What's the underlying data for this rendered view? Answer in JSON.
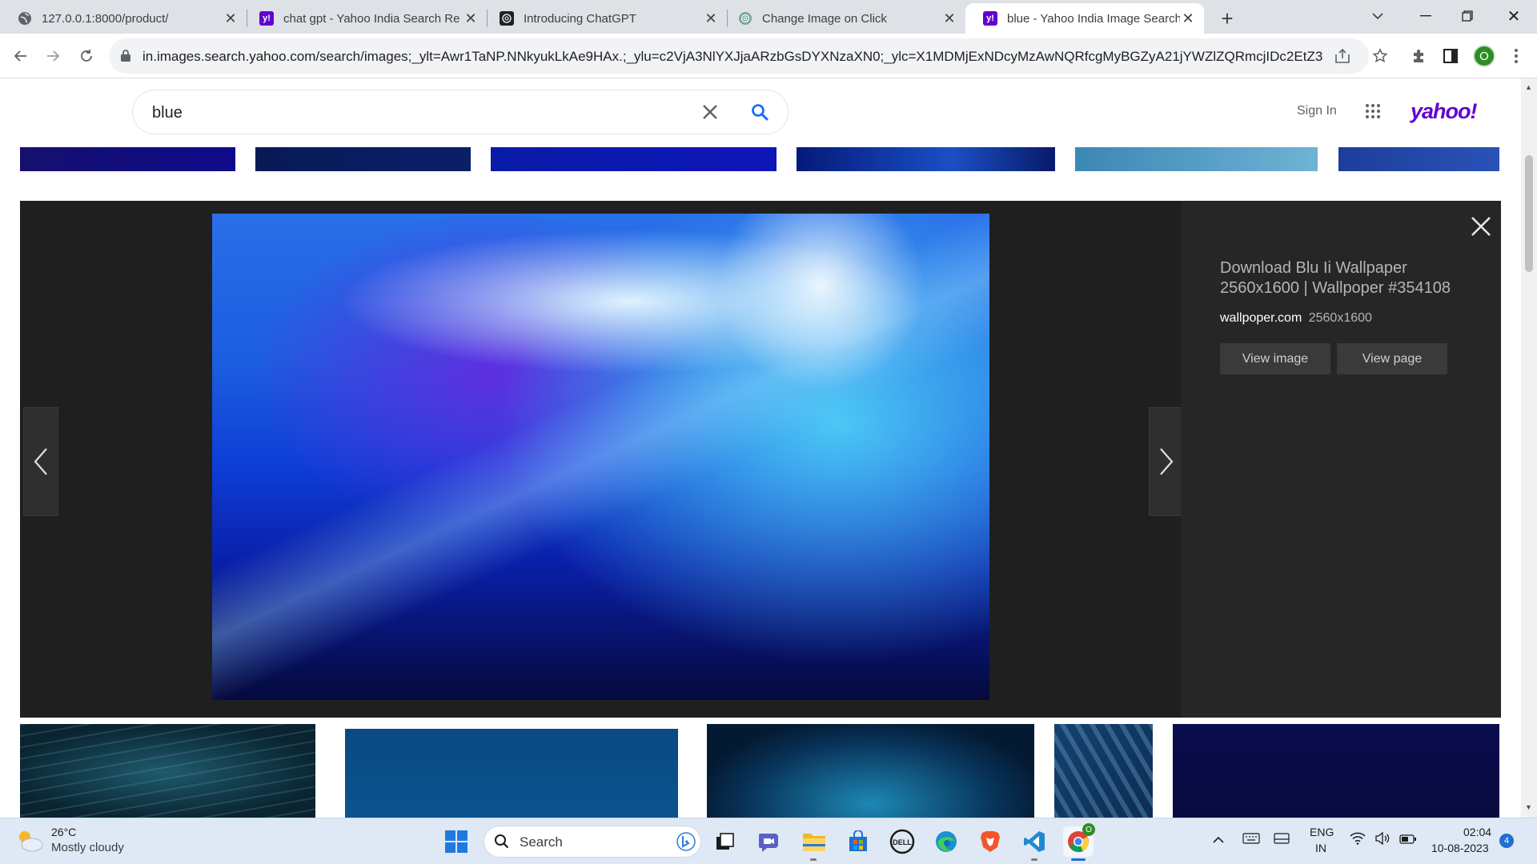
{
  "browser": {
    "tabs": [
      {
        "title": "127.0.0.1:8000/product/",
        "icon": "globe-icon"
      },
      {
        "title": "chat gpt - Yahoo India Search Re",
        "icon": "yahoo-icon"
      },
      {
        "title": "Introducing ChatGPT",
        "icon": "openai-icon"
      },
      {
        "title": "Change Image on Click",
        "icon": "openai-icon"
      },
      {
        "title": "blue - Yahoo India Image Search",
        "icon": "yahoo-icon",
        "active": true
      }
    ],
    "url": "in.images.search.yahoo.com/search/images;_ylt=Awr1TaNP.NNkyukLkAe9HAx.;_ylu=c2VjA3NlYXJjaARzbGsDYXNzaXN0;_ylc=X1MDMjExNDcyMzAwNQRfcgMyBGZyA21jYWZlZQRmcjIDc2EtZ3...",
    "profile_initial": "O"
  },
  "yahoo": {
    "search_value": "blue",
    "sign_in": "Sign In",
    "logo": "yahoo!"
  },
  "viewer": {
    "title": "Download Blu Ii Wallpaper 2560x1600 | Wallpoper #354108",
    "source": "wallpoper.com",
    "size": "2560x1600",
    "view_image": "View image",
    "view_page": "View page"
  },
  "taskbar": {
    "weather_temp": "26°C",
    "weather_desc": "Mostly cloudy",
    "search_label": "Search",
    "lang_top": "ENG",
    "lang_bottom": "IN",
    "time": "02:04",
    "date": "10-08-2023",
    "notifications": "4",
    "chrome_badge": "O"
  },
  "colors": {
    "yahoo_purple": "#6001d2",
    "search_blue": "#0f69ff",
    "viewer_bg": "#1f1f1f"
  }
}
